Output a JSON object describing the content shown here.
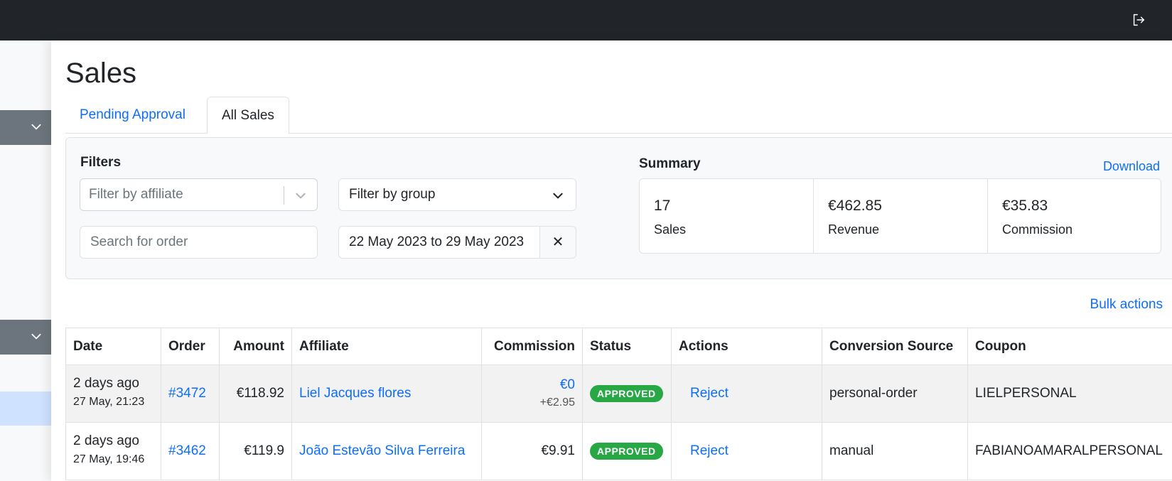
{
  "topbar": {
    "logout_icon": "logout-icon"
  },
  "sidebar": {
    "chevron_icon": "chevron-down-icon"
  },
  "page": {
    "title": "Sales"
  },
  "tabs": [
    {
      "label": "Pending Approval",
      "active": false
    },
    {
      "label": "All Sales",
      "active": true
    }
  ],
  "filters": {
    "heading": "Filters",
    "affiliate_placeholder": "Filter by affiliate",
    "group_placeholder": "Filter by group",
    "search_placeholder": "Search for order",
    "date_range": "22 May 2023 to 29 May 2023",
    "clear_label": "✕"
  },
  "summary": {
    "heading": "Summary",
    "download_label": "Download",
    "stats": [
      {
        "value": "17",
        "label": "Sales"
      },
      {
        "value": "€462.85",
        "label": "Revenue"
      },
      {
        "value": "€35.83",
        "label": "Commission"
      }
    ]
  },
  "bulk_actions_label": "Bulk actions",
  "table": {
    "headers": [
      "Date",
      "Order",
      "Amount",
      "Affiliate",
      "Commission",
      "Status",
      "Actions",
      "Conversion Source",
      "Coupon"
    ],
    "rows": [
      {
        "date_relative": "2 days ago",
        "date_absolute": "27 May, 21:23",
        "order": "#3472",
        "amount": "€118.92",
        "affiliate": "Liel Jacques flores",
        "commission": "€0",
        "commission_extra": "+€2.95",
        "status": "APPROVED",
        "action": "Reject",
        "source": "personal-order",
        "coupon": "LIELPERSONAL"
      },
      {
        "date_relative": "2 days ago",
        "date_absolute": "27 May, 19:46",
        "order": "#3462",
        "amount": "€119.9",
        "affiliate": "João Estevão Silva Ferreira",
        "commission": "€9.91",
        "commission_extra": "",
        "status": "APPROVED",
        "action": "Reject",
        "source": "manual",
        "coupon": "FABIANOAMARALPERSONAL"
      }
    ]
  },
  "colors": {
    "topbar": "#212529",
    "link": "#0d6efd",
    "approved_badge": "#28a745",
    "sidebar_block": "#6c757d",
    "sidebar_active": "#cfe2ff"
  }
}
